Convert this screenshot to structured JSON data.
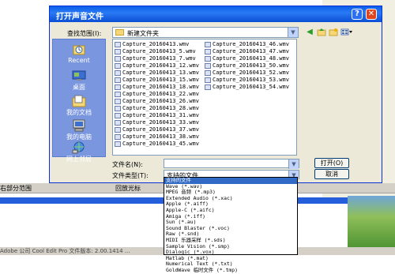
{
  "background": {
    "toolbar_left": "右部分范围",
    "toolbar_mid": "回放光标",
    "status": "Adobe 公司  Cool Edit Pro  文件版本: 2.00.1414  ...",
    "colors": {
      "dialog_title": "#0a5fe8",
      "places_bar": "#7a96df",
      "selection": "#316ac5",
      "wave_band": "#245edb"
    }
  },
  "dialog": {
    "title": "打开声音文件",
    "help_glyph": "?",
    "close_glyph": "✕",
    "look_in_label": "查找范围(I):",
    "look_in_value": "新建文件夹",
    "nav_icons": [
      "back-icon",
      "up-folder-icon",
      "new-folder-icon",
      "view-menu-icon"
    ],
    "places": [
      {
        "label": "Recent",
        "icon": "recent-icon"
      },
      {
        "label": "桌面",
        "icon": "desktop-icon"
      },
      {
        "label": "我的文档",
        "icon": "my-documents-icon"
      },
      {
        "label": "我的电脑",
        "icon": "my-computer-icon"
      },
      {
        "label": "网上邻居",
        "icon": "network-icon"
      }
    ],
    "files_col1": [
      "Capture_20160413.wmv",
      "Capture_20160413_5.wmv",
      "Capture_20160413_7.wmv",
      "Capture_20160413_12.wmv",
      "Capture_20160413_13.wmv",
      "Capture_20160413_15.wmv",
      "Capture_20160413_18.wmv",
      "Capture_20160413_22.wmv",
      "Capture_20160413_26.wmv",
      "Capture_20160413_28.wmv",
      "Capture_20160413_31.wmv",
      "Capture_20160413_33.wmv",
      "Capture_20160413_37.wmv",
      "Capture_20160413_38.wmv",
      "Capture_20160413_45.wmv"
    ],
    "files_col2": [
      "Capture_20160413_46.wmv",
      "Capture_20160413_47.wmv",
      "Capture_20160413_48.wmv",
      "Capture_20160413_50.wmv",
      "Capture_20160413_52.wmv",
      "Capture_20160413_53.wmv",
      "Capture_20160413_54.wmv"
    ],
    "filename_label": "文件名(N):",
    "filename_value": "",
    "filetype_label": "文件类型(T):",
    "filetype_value": "支持的文件",
    "open_button": "打开(O)",
    "cancel_button": "取消"
  },
  "filetype_options": [
    "支持的文件",
    "Wave (*.wav)",
    "MPEG 音频 (*.mp3)",
    "Extended Audio (*.xac)",
    "Apple (*.aiff)",
    "Apple-C (*.aifc)",
    "Amiga (*.iff)",
    "Sun (*.au)",
    "Sound Blaster (*.voc)",
    "Raw (*.snd)",
    "MIDI 乐器采样 (*.sds)",
    "Sample Vision (*.smp)",
    "Dialogic (*.vox)",
    "Matlab (*.mat)",
    "Numerical Text (*.txt)",
    "GoldWave 临时文件 (*.tmp)"
  ]
}
